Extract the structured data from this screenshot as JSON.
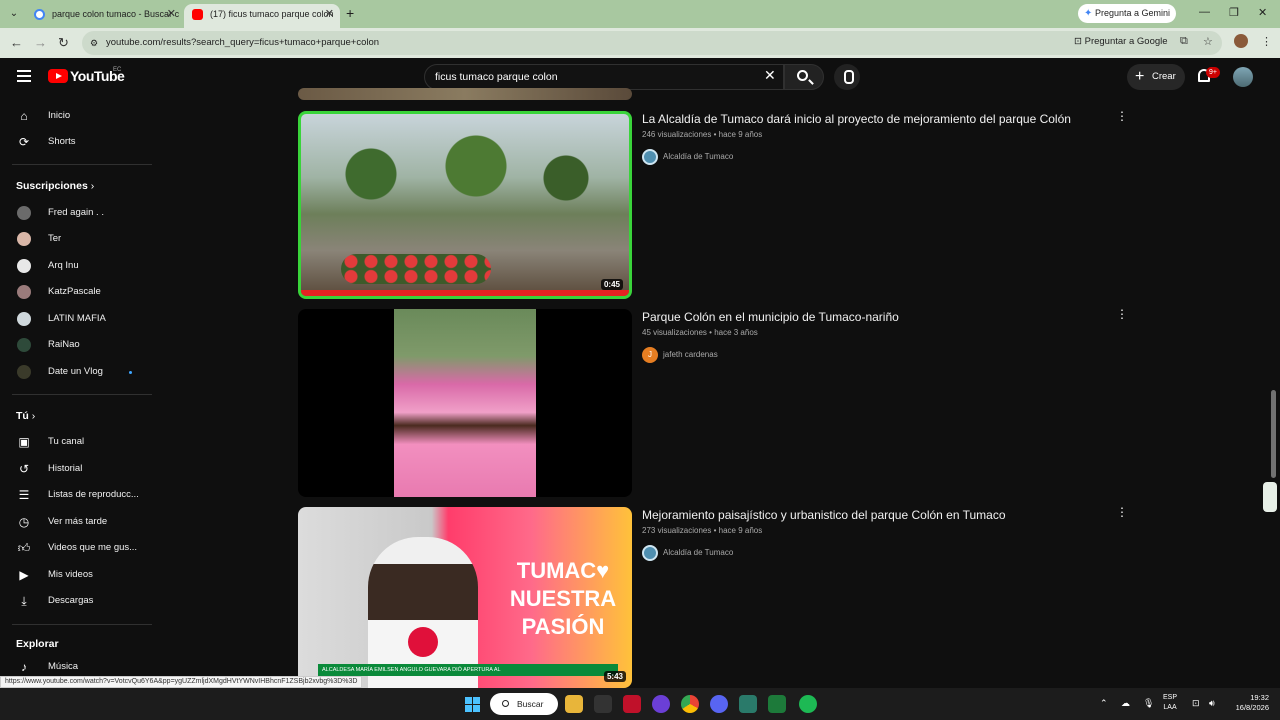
{
  "browser": {
    "tabs": [
      {
        "label": "parque colon tumaco - Buscar c"
      },
      {
        "label": "(17) ficus tumaco parque colon"
      }
    ],
    "gemini_label": "Pregunta a Gemini",
    "url": "youtube.com/results?search_query=ficus+tumaco+parque+colon",
    "ask_google_label": "Preguntar a Google"
  },
  "youtube": {
    "logo_text": "YouTube",
    "country": "EC",
    "search_value": "ficus tumaco parque colon",
    "create_label": "Crear",
    "notif_count": "9+"
  },
  "sidebar": {
    "main": [
      {
        "label": "Inicio",
        "icon": "home-icon"
      },
      {
        "label": "Shorts",
        "icon": "shorts-icon"
      }
    ],
    "subs_heading": "Suscripciones",
    "subs": [
      {
        "label": "Fred again . .",
        "color": "#6b6b6b"
      },
      {
        "label": "Ter",
        "color": "#d9b7a8"
      },
      {
        "label": "Arq Inu",
        "color": "#e8e8e8"
      },
      {
        "label": "KatzPascale",
        "color": "#9a7b7b"
      },
      {
        "label": "LATIN MAFIA",
        "color": "#cfd8dc"
      },
      {
        "label": "RaiNao",
        "color": "#2e4a3a"
      },
      {
        "label": "Date un Vlog",
        "color": "#3a3a2a"
      }
    ],
    "you_heading": "Tú",
    "you": [
      {
        "label": "Tu canal",
        "icon": "channel-icon"
      },
      {
        "label": "Historial",
        "icon": "history-icon"
      },
      {
        "label": "Listas de reproducc...",
        "icon": "playlist-icon"
      },
      {
        "label": "Ver más tarde",
        "icon": "clock-icon"
      },
      {
        "label": "Videos que me gus...",
        "icon": "thumbs-up-icon"
      },
      {
        "label": "Mis videos",
        "icon": "video-icon"
      },
      {
        "label": "Descargas",
        "icon": "download-icon"
      }
    ],
    "explore_heading": "Explorar",
    "explore": [
      {
        "label": "Música",
        "icon": "music-icon"
      }
    ]
  },
  "results": [
    {
      "title": "La Alcaldía de Tumaco dará inicio al proyecto de mejoramiento del parque Colón",
      "views": "246 visualizaciones",
      "age": "hace 9 años",
      "channel": "Alcaldía de Tumaco",
      "duration": "0:45"
    },
    {
      "title": "Parque Colón en el municipio de Tumaco-nariño",
      "views": "45 visualizaciones",
      "age": "hace 3 años",
      "channel": "jafeth cardenas",
      "channel_initial": "J",
      "duration": ""
    },
    {
      "title": "Mejoramiento paisajístico y urbanistico del parque Colón en Tumaco",
      "views": "273 visualizaciones",
      "age": "hace 9 años",
      "channel": "Alcaldía de Tumaco",
      "duration": "5:43",
      "thumb_text": "TUMAC♥ NUESTRA PASIÓN",
      "thumb_caption": "ALCALDESA MARÍA EMILSEN ANGULO GUEVARA DIÓ APERTURA AL"
    }
  ],
  "status_url": "https://www.youtube.com/watch?v=VotcvQu6Y6A&pp=ygUZZmljdXMgdHVtYWNvIHBhcnF1ZSBjb2xvbg%3D%3D",
  "taskbar": {
    "search_label": "Buscar",
    "lang1": "ESP",
    "lang2": "LAA",
    "time": "19:32",
    "date": "16/8/2026"
  }
}
